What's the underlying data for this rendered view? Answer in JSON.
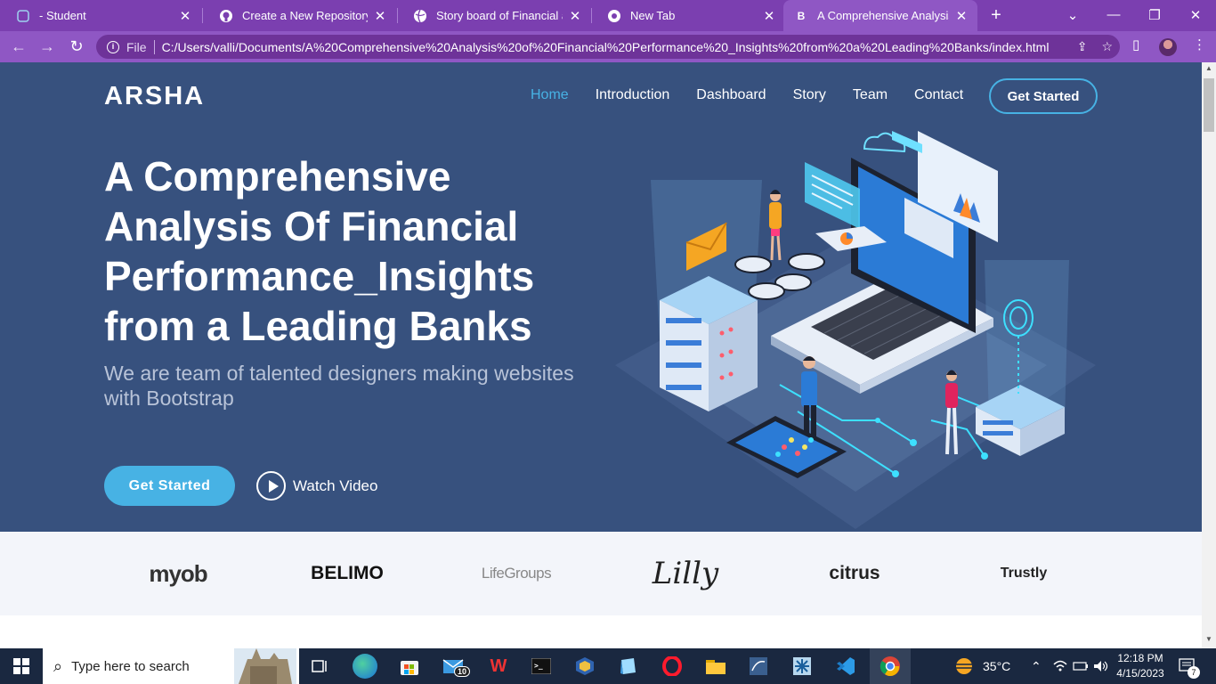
{
  "browser": {
    "tabs": [
      {
        "label": "- Student",
        "close": "✕"
      },
      {
        "label": "Create a New Repository",
        "close": "✕"
      },
      {
        "label": "Story board of Financial analy",
        "close": "✕"
      },
      {
        "label": "New Tab",
        "close": "✕"
      },
      {
        "label": "A Comprehensive Analysis Of",
        "close": "✕"
      }
    ],
    "new_tab": "+",
    "window_controls": {
      "tab_search": "⌄",
      "minimize": "—",
      "restore": "❐",
      "close": "✕"
    },
    "address": {
      "scheme_label": "File",
      "url": "C:/Users/valli/Documents/A%20Comprehensive%20Analysis%20of%20Financial%20Performance%20_Insights%20from%20a%20Leading%20Banks/index.html"
    }
  },
  "site": {
    "logo": "ARSHA",
    "nav": [
      {
        "label": "Home",
        "active": true
      },
      {
        "label": "Introduction",
        "active": false
      },
      {
        "label": "Dashboard",
        "active": false
      },
      {
        "label": "Story",
        "active": false
      },
      {
        "label": "Team",
        "active": false
      },
      {
        "label": "Contact",
        "active": false
      }
    ],
    "nav_cta": "Get Started",
    "hero": {
      "title": "A Comprehensive Analysis Of Financial Performance_Insights from a Leading Banks",
      "subtitle": "We are team of talented designers making websites with Bootstrap",
      "primary_button": "Get Started",
      "video_link": "Watch Video"
    },
    "clients": [
      "myob",
      "BELIMO",
      "LifeGroups",
      "Lilly",
      "citrus",
      "Trustly"
    ]
  },
  "taskbar": {
    "search_placeholder": "Type here to search",
    "mail_badge": "10",
    "weather": "35°C",
    "time": "12:18 PM",
    "date": "4/15/2023",
    "notification_badge": "7"
  },
  "colors": {
    "hero_bg": "#37517e",
    "accent": "#47b2e4",
    "browser_frame": "#7b3fb0",
    "taskbar": "#1a2840"
  }
}
